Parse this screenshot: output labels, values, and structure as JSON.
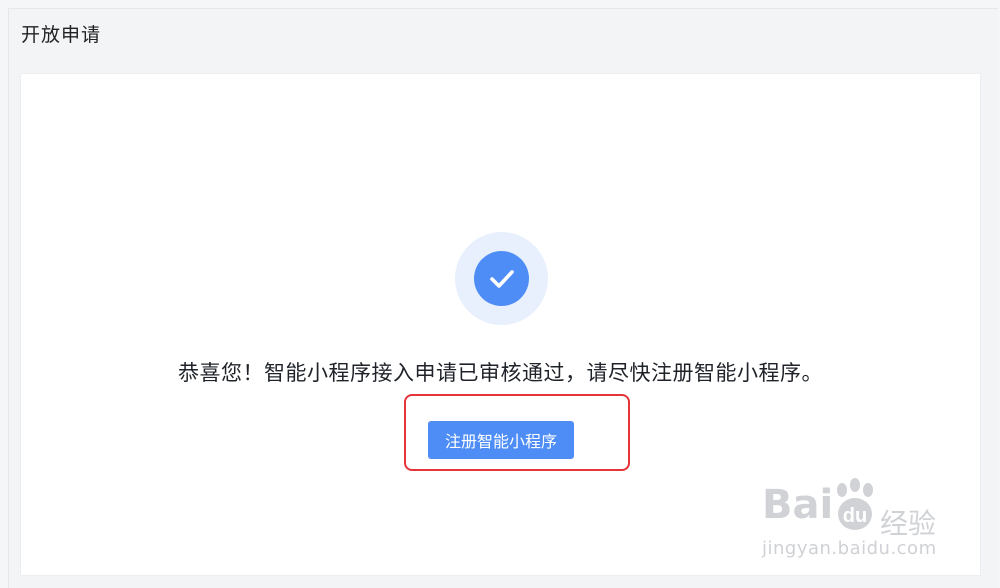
{
  "header": {
    "title": "开放申请"
  },
  "result": {
    "message": "恭喜您！智能小程序接入申请已审核通过，请尽快注册智能小程序。",
    "register_button_label": "注册智能小程序",
    "status_icon": "check-circle-icon"
  },
  "watermark": {
    "brand_latin": "Bai",
    "brand_du": "du",
    "brand_cn": "经验",
    "url": "jingyan.baidu.com"
  },
  "colors": {
    "accent": "#4e8df5",
    "success_ring": "#e8f0fd",
    "highlight_border": "#e5343a"
  }
}
